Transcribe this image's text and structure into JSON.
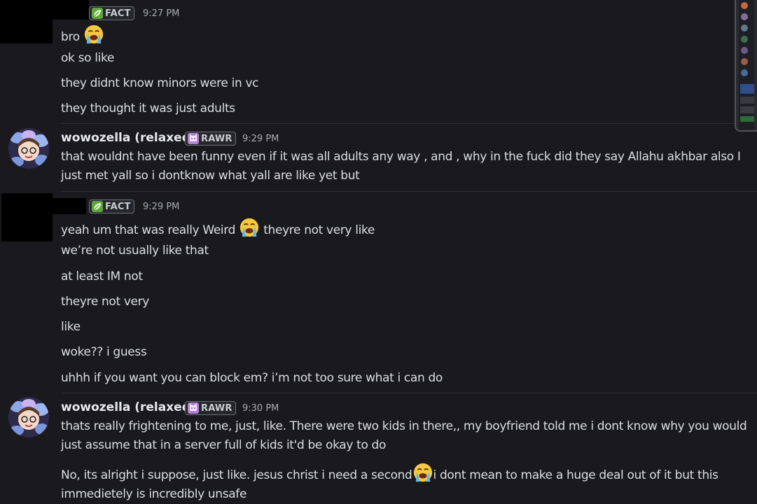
{
  "messages": [
    {
      "author": "",
      "tag": "FACT",
      "time": "9:27 PM",
      "lines": [
        "bro",
        "ok so like",
        "they didnt know minors were in vc",
        "they thought it was just adults"
      ]
    },
    {
      "author": "wowozella (relaxed)",
      "tag": "RAWR",
      "time": "9:29 PM",
      "lines": [
        "that wouldnt have been funny even if it was all adults any way ,  and , why in the fuck did they say Allahu akhbar  also I just  met yall so i dontknow what yall are like yet but"
      ]
    },
    {
      "author": "",
      "tag": "FACT",
      "time": "9:29 PM",
      "lines": [
        "yeah um that was really Weird",
        "theyre not very like",
        "we’re not usually like that",
        "at least IM not",
        "theyre not very",
        "like",
        "woke?? i guess",
        "uhhh if you want you can block em? i’m not too sure what i can do"
      ]
    },
    {
      "author": "wowozella (relaxed)",
      "tag": "RAWR",
      "time": "9:30 PM",
      "lines": [
        "thats really frightening to me,   just,  like.  There were two kids in there,, my boyfriend told me  i dont know why you would just assume that in a server full of kids it'd be okay to do",
        "No, its alright i suppose,  just like. jesus christ  i need a second",
        "i dont mean to make a huge deal out of it but  this immedietely is incredibly unsafe"
      ]
    }
  ],
  "icons": {
    "fact_tag": "leaf-icon",
    "rawr_tag": "cat-face-icon",
    "emoji": "loudly-crying-face-emoji"
  },
  "colors": {
    "background": "#1a1a1e",
    "text": "#dbdee1",
    "username": "#e8e9ec",
    "timestamp": "#a8abb2",
    "fact_leaf": "#5aa83a",
    "rawr_cat": "#b57fd6"
  }
}
